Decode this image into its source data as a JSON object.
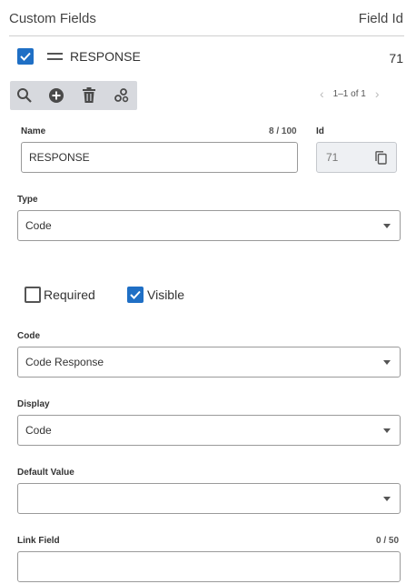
{
  "header": {
    "title": "Custom Fields",
    "right_label": "Field Id"
  },
  "row": {
    "label": "RESPONSE",
    "id": "71"
  },
  "icons": {
    "search": "search-icon",
    "add": "add-circle-icon",
    "delete": "trash-icon",
    "settings": "gears-icon",
    "copy": "copy-icon",
    "prev": "chevron-left-icon",
    "next": "chevron-right-icon"
  },
  "pager": {
    "text": "1–1 of 1"
  },
  "form": {
    "name": {
      "label": "Name",
      "value": "RESPONSE",
      "counter": "8 / 100"
    },
    "id": {
      "label": "Id",
      "value": "71"
    },
    "type": {
      "label": "Type",
      "value": "Code"
    },
    "required": {
      "label": "Required",
      "checked": false
    },
    "visible": {
      "label": "Visible",
      "checked": true
    },
    "code": {
      "label": "Code",
      "value": "Code Response"
    },
    "display": {
      "label": "Display",
      "value": "Code"
    },
    "default_value": {
      "label": "Default Value",
      "value": ""
    },
    "link_field": {
      "label": "Link Field",
      "value": "",
      "counter": "0 / 50"
    }
  },
  "colors": {
    "accent": "#1f6fc5",
    "toolbar_bg": "#d7d9de"
  }
}
